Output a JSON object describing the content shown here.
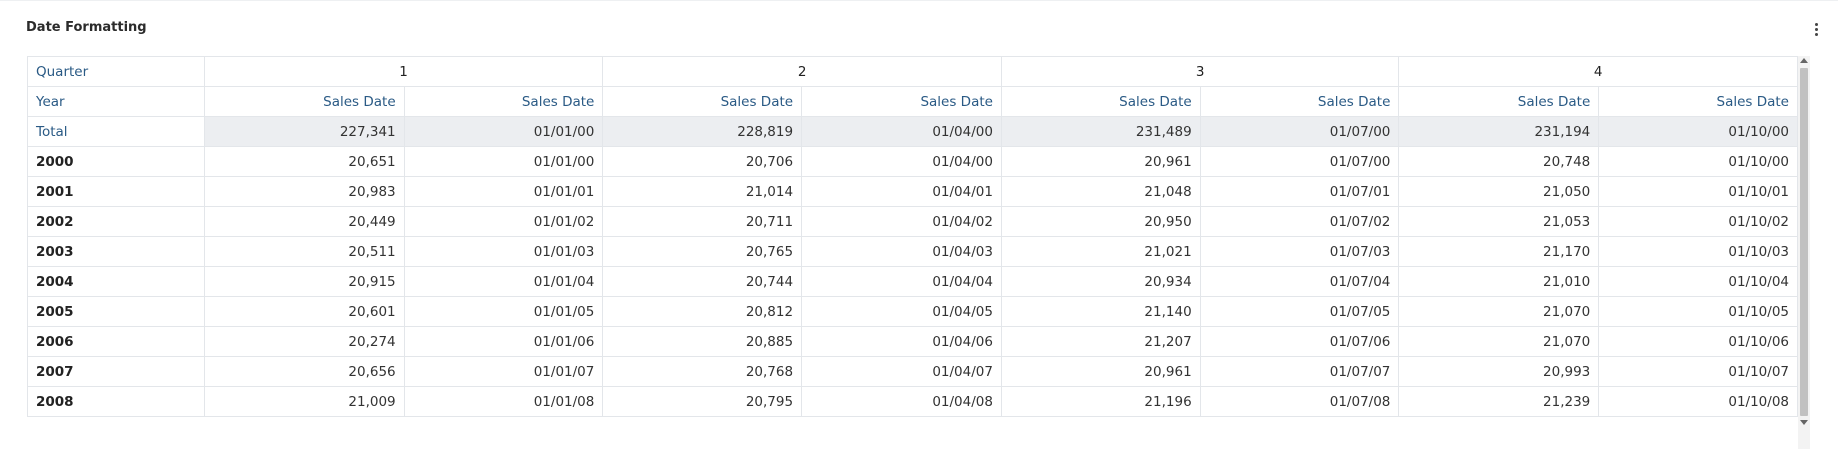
{
  "title": "Date Formatting",
  "menu_icon": "more-vertical-icon",
  "pivot": {
    "row_header_label_quarter": "Quarter",
    "row_header_label_year": "Year",
    "quarters": [
      "1",
      "2",
      "3",
      "4"
    ],
    "column_headers": [
      "Sales Date",
      "Sales Date",
      "Sales Date",
      "Sales Date",
      "Sales Date",
      "Sales Date",
      "Sales Date",
      "Sales Date"
    ],
    "total": {
      "label": "Total",
      "cells": [
        "227,341",
        "01/01/00",
        "228,819",
        "01/04/00",
        "231,489",
        "01/07/00",
        "231,194",
        "01/10/00"
      ]
    },
    "rows": [
      {
        "label": "2000",
        "cells": [
          "20,651",
          "01/01/00",
          "20,706",
          "01/04/00",
          "20,961",
          "01/07/00",
          "20,748",
          "01/10/00"
        ]
      },
      {
        "label": "2001",
        "cells": [
          "20,983",
          "01/01/01",
          "21,014",
          "01/04/01",
          "21,048",
          "01/07/01",
          "21,050",
          "01/10/01"
        ]
      },
      {
        "label": "2002",
        "cells": [
          "20,449",
          "01/01/02",
          "20,711",
          "01/04/02",
          "20,950",
          "01/07/02",
          "21,053",
          "01/10/02"
        ]
      },
      {
        "label": "2003",
        "cells": [
          "20,511",
          "01/01/03",
          "20,765",
          "01/04/03",
          "21,021",
          "01/07/03",
          "21,170",
          "01/10/03"
        ]
      },
      {
        "label": "2004",
        "cells": [
          "20,915",
          "01/01/04",
          "20,744",
          "01/04/04",
          "20,934",
          "01/07/04",
          "21,010",
          "01/10/04"
        ]
      },
      {
        "label": "2005",
        "cells": [
          "20,601",
          "01/01/05",
          "20,812",
          "01/04/05",
          "21,140",
          "01/07/05",
          "21,070",
          "01/10/05"
        ]
      },
      {
        "label": "2006",
        "cells": [
          "20,274",
          "01/01/06",
          "20,885",
          "01/04/06",
          "21,207",
          "01/07/06",
          "21,070",
          "01/10/06"
        ]
      },
      {
        "label": "2007",
        "cells": [
          "20,656",
          "01/01/07",
          "20,768",
          "01/04/07",
          "20,961",
          "01/07/07",
          "20,993",
          "01/10/07"
        ]
      },
      {
        "label": "2008",
        "cells": [
          "21,009",
          "01/01/08",
          "20,795",
          "01/04/08",
          "21,196",
          "01/07/08",
          "21,239",
          "01/10/08"
        ]
      }
    ]
  },
  "colors": {
    "header_text": "#2a5a85",
    "total_row_bg": "#eceef1",
    "border": "#e3e6ea"
  }
}
